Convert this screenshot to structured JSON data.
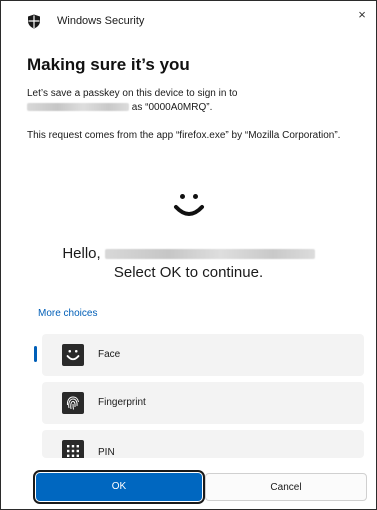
{
  "window": {
    "app_title": "Windows Security",
    "close_glyph": "×"
  },
  "dialog": {
    "heading": "Making sure it’s you",
    "para1_line1": "Let’s save a passkey on this device to sign in to",
    "para1_line2_suffix": "as “0000A0MRQ”.",
    "para2": "This request comes from the app “firefox.exe” by “Mozilla Corporation”.",
    "hello_prefix": "Hello,",
    "select_ok": "Select OK to continue.",
    "more_choices": "More choices"
  },
  "options": [
    {
      "label": "Face",
      "icon": "face-icon",
      "selected": true
    },
    {
      "label": "Fingerprint",
      "icon": "fingerprint-icon",
      "selected": false
    },
    {
      "label": "PIN",
      "icon": "pin-keypad-icon",
      "selected": false
    }
  ],
  "buttons": {
    "ok": "OK",
    "cancel": "Cancel"
  },
  "colors": {
    "accent": "#0067c0",
    "link": "#005fb8",
    "option_bg": "#f3f3f3"
  }
}
